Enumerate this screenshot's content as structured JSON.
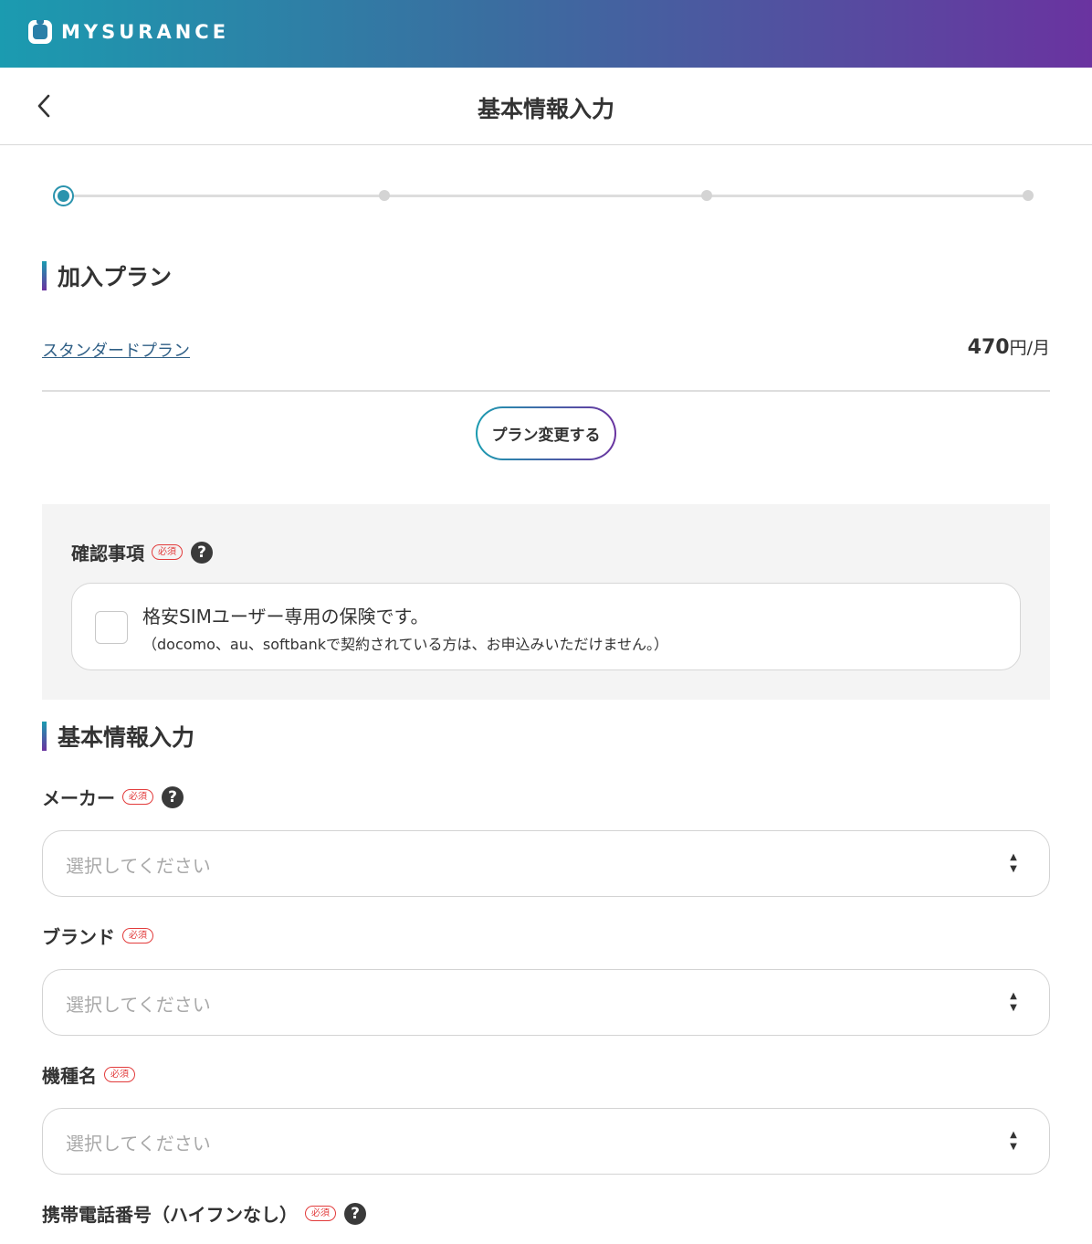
{
  "brand": {
    "logo_text": "MYSURANCE"
  },
  "header": {
    "title": "基本情報入力",
    "back_icon": "chevron-left-icon"
  },
  "stepper": {
    "total_steps": 4,
    "current_step": 1
  },
  "plan_section": {
    "title": "加入プラン",
    "plan_name": "スタンダードプラン",
    "price_value": "470",
    "price_unit": "円/月",
    "change_button": "プラン変更する"
  },
  "confirm_section": {
    "label": "確認事項",
    "required_badge": "必須",
    "help_icon": "question-circle-icon",
    "checkbox_checked": false,
    "main_text": "格安SIMユーザー専用の保険です。",
    "sub_text": "（docomo、au、softbankで契約されている方は、お申込みいただけません。）"
  },
  "basic_info": {
    "title": "基本情報入力",
    "fields": [
      {
        "label": "メーカー",
        "required": "必須",
        "placeholder": "選択してください"
      },
      {
        "label": "ブランド",
        "required": "必須",
        "placeholder": "選択してください"
      },
      {
        "label": "機種名",
        "required": "必須",
        "placeholder": "選択してください"
      },
      {
        "label": "携帯電話番号（ハイフンなし）",
        "required": "必須"
      }
    ]
  },
  "colors": {
    "gradient_start": "#1b9bb0",
    "gradient_end": "#6a33a0",
    "required": "#e23b3b",
    "link": "#2f5f86"
  }
}
